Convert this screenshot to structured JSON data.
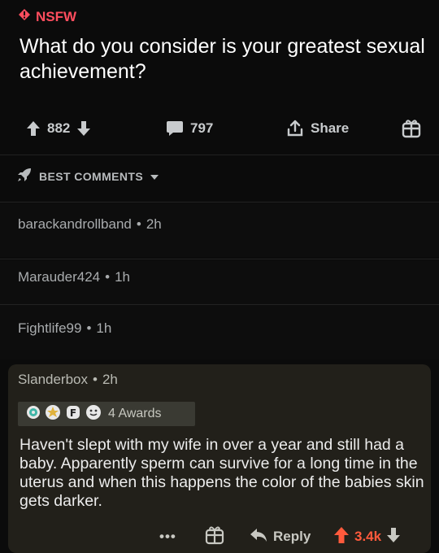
{
  "post": {
    "flair": "NSFW",
    "title": "What do you consider is your greatest sexual achievement?"
  },
  "actions": {
    "vote_count": "882",
    "comment_count": "797",
    "share_label": "Share"
  },
  "sort": {
    "label": "BEST COMMENTS"
  },
  "comments": [
    {
      "author": "barackandrollband",
      "separator": "•",
      "age": "2h"
    },
    {
      "author": "Marauder424",
      "separator": "•",
      "age": "1h"
    },
    {
      "author": "Fightlife99",
      "separator": "•",
      "age": "1h"
    }
  ],
  "highlighted_comment": {
    "author": "Slanderbox",
    "separator": "•",
    "age": "2h",
    "awards_label": "4 Awards",
    "body": "Haven't slept with my wife in over a year and still had a baby. Apparently sperm can survive for a long time in the uterus and when this happens the color of the babies skin gets darker.",
    "more_label": "•••",
    "reply_label": "Reply",
    "score": "3.4k"
  },
  "colors": {
    "background": "#0b0b0b",
    "nsfw": "#ff4d5e",
    "upvoted": "#ff5a3c",
    "highlight_bg": "#22201a"
  },
  "icons": [
    "nsfw-diamond-icon",
    "upvote-icon",
    "downvote-icon",
    "comment-icon",
    "share-icon",
    "gift-icon",
    "rocket-icon",
    "chevron-down-icon",
    "award-icon",
    "reply-icon",
    "more-icon"
  ]
}
